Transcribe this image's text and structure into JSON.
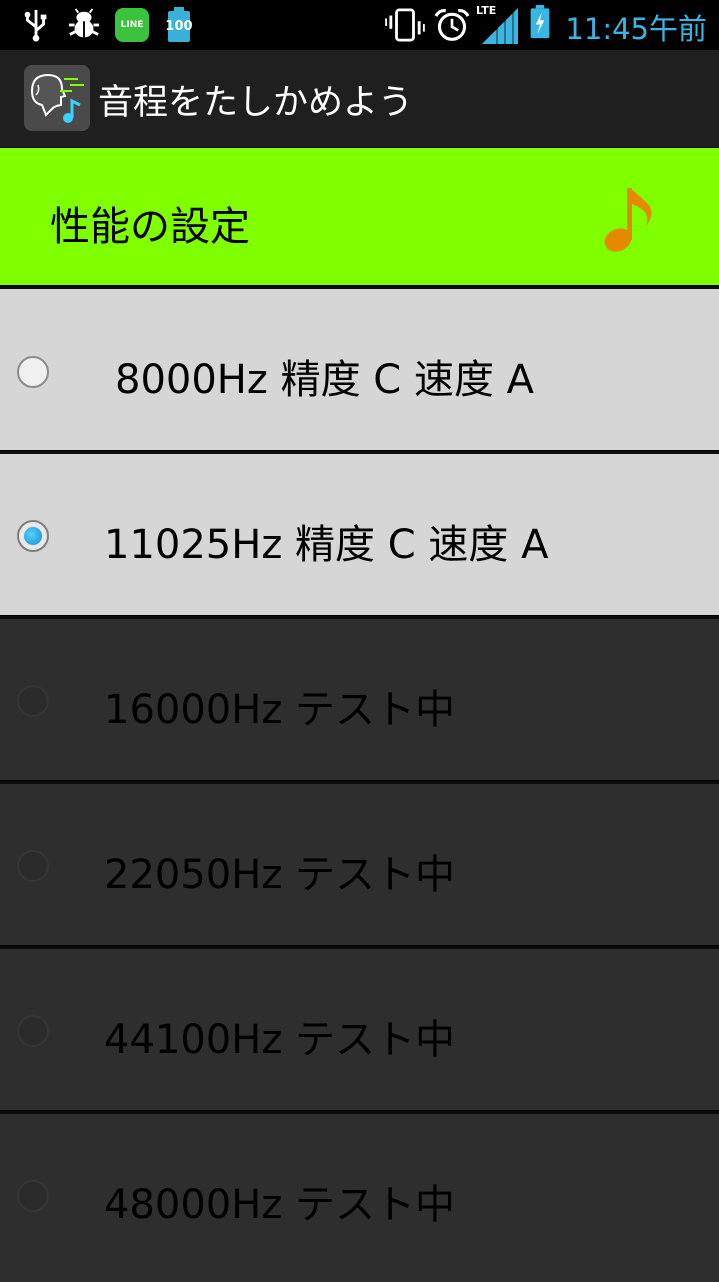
{
  "status_bar": {
    "time": "11:45午前",
    "line_label": "LINE",
    "battery_small_label": "100",
    "lte_label": "LTE",
    "icons": [
      "usb-icon",
      "bug-icon",
      "line-icon",
      "battery-full-icon",
      "vibrate-icon",
      "alarm-icon",
      "lte-signal-icon",
      "battery-charging-icon"
    ]
  },
  "app_bar": {
    "title": "音程をたしかめよう"
  },
  "header": {
    "title": "性能の設定",
    "icon": "music-note-icon",
    "accent_color": "#7fff00",
    "note_color": "#e58a00"
  },
  "options": [
    {
      "label": "8000Hz 精度 C 速度 A",
      "checked": false,
      "enabled": true
    },
    {
      "label": "11025Hz 精度 C 速度 A",
      "checked": true,
      "enabled": true
    },
    {
      "label": "16000Hz テスト中",
      "checked": false,
      "enabled": false
    },
    {
      "label": "22050Hz テスト中",
      "checked": false,
      "enabled": false
    },
    {
      "label": "44100Hz テスト中",
      "checked": false,
      "enabled": false
    },
    {
      "label": "48000Hz テスト中",
      "checked": false,
      "enabled": false
    }
  ]
}
